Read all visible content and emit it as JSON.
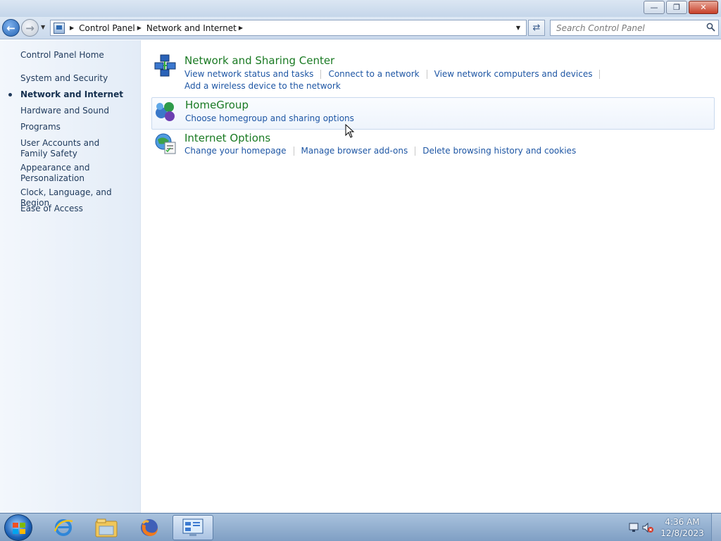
{
  "window": {
    "buttons": {
      "minimize": "—",
      "restore": "❐",
      "close": "✕"
    }
  },
  "address": {
    "back_icon": "back-arrow-icon",
    "forward_icon": "forward-arrow-icon",
    "crumbs": [
      "Control Panel",
      "Network and Internet"
    ],
    "search_placeholder": "Search Control Panel"
  },
  "sidebar": {
    "home": "Control Panel Home",
    "items": [
      {
        "label": "System and Security",
        "active": false
      },
      {
        "label": "Network and Internet",
        "active": true
      },
      {
        "label": "Hardware and Sound",
        "active": false
      },
      {
        "label": "Programs",
        "active": false
      },
      {
        "label": "User Accounts and Family Safety",
        "active": false
      },
      {
        "label": "Appearance and Personalization",
        "active": false
      },
      {
        "label": "Clock, Language, and Region",
        "active": false
      },
      {
        "label": "Ease of Access",
        "active": false
      }
    ]
  },
  "categories": [
    {
      "title": "Network and Sharing Center",
      "icon": "network-sharing-icon",
      "tasks_line1": [
        "View network status and tasks",
        "Connect to a network",
        "View network computers and devices"
      ],
      "tasks_line2": [
        "Add a wireless device to the network"
      ]
    },
    {
      "title": "HomeGroup",
      "icon": "homegroup-icon",
      "tasks_line1": [
        "Choose homegroup and sharing options"
      ]
    },
    {
      "title": "Internet Options",
      "icon": "internet-options-icon",
      "tasks_line1": [
        "Change your homepage",
        "Manage browser add-ons",
        "Delete browsing history and cookies"
      ]
    }
  ],
  "taskbar": {
    "apps": [
      "internet-explorer-icon",
      "windows-explorer-icon",
      "firefox-icon",
      "control-panel-icon"
    ],
    "clock_time": "4:36 AM",
    "clock_date": "12/8/2023"
  }
}
